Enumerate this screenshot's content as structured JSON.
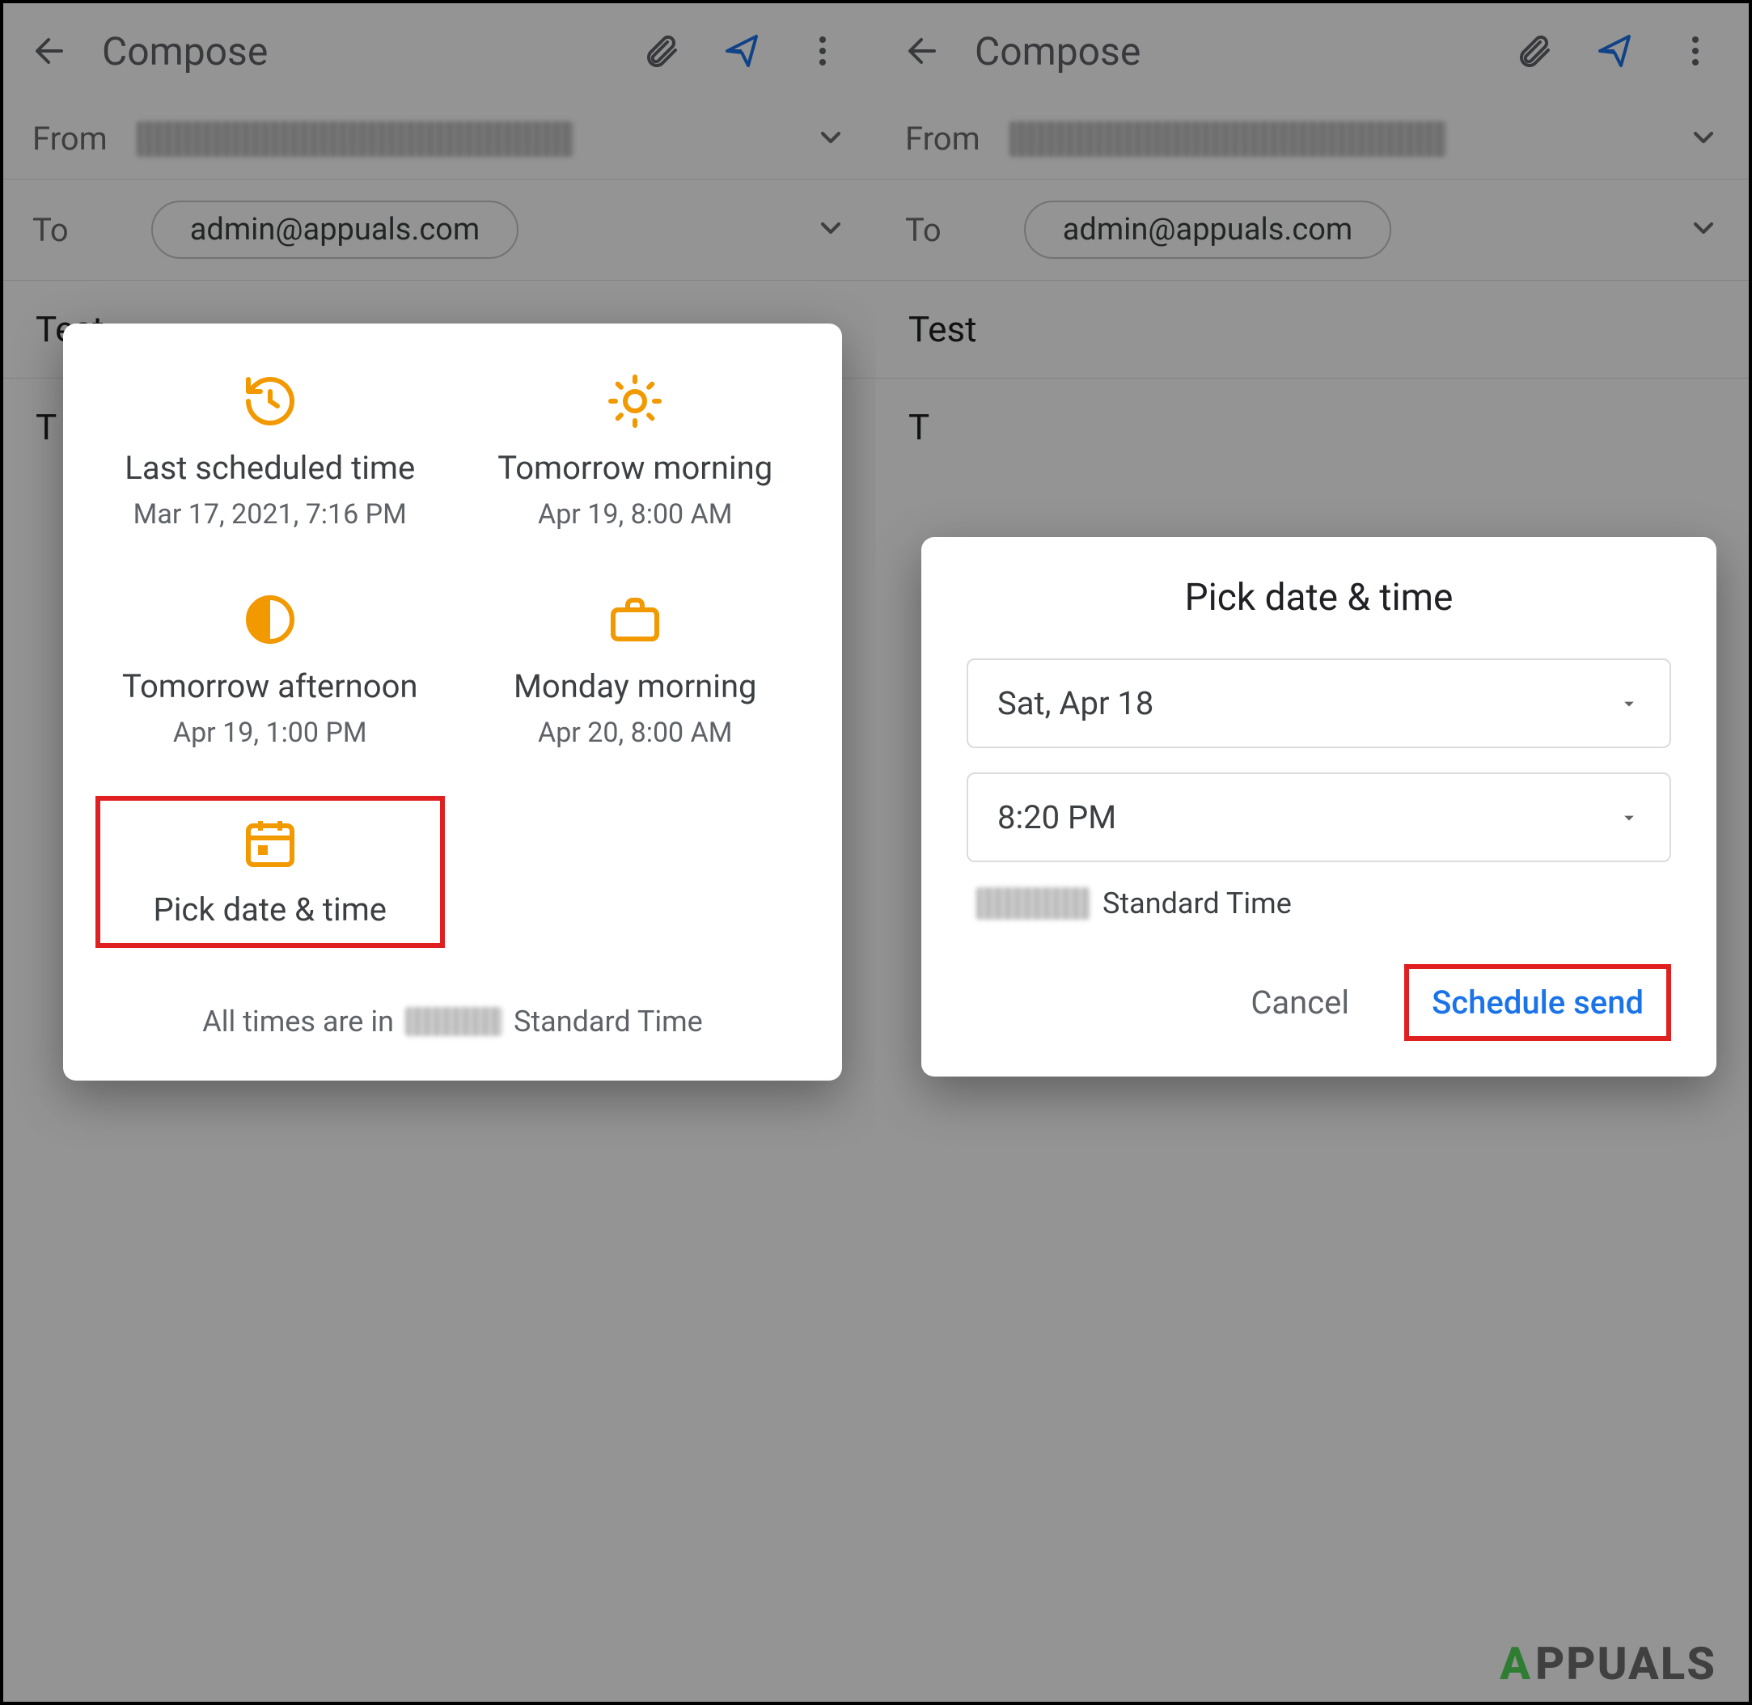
{
  "appbar": {
    "title": "Compose"
  },
  "from_label": "From",
  "to_label": "To",
  "to_chip": "admin@appuals.com",
  "subject": "Test",
  "body_initial": "T",
  "schedule": {
    "options": [
      {
        "label": "Last scheduled time",
        "sub": "Mar 17, 2021, 7:16 PM"
      },
      {
        "label": "Tomorrow morning",
        "sub": "Apr 19, 8:00 AM"
      },
      {
        "label": "Tomorrow afternoon",
        "sub": "Apr 19, 1:00 PM"
      },
      {
        "label": "Monday morning",
        "sub": "Apr 20, 8:00 AM"
      },
      {
        "label": "Pick date & time",
        "sub": ""
      }
    ],
    "footer_prefix": "All times are in",
    "footer_suffix": "Standard Time"
  },
  "pick": {
    "title": "Pick date & time",
    "date": "Sat, Apr 18",
    "time": "8:20 PM",
    "tz_suffix": "Standard Time",
    "cancel": "Cancel",
    "confirm": "Schedule send"
  },
  "watermark": "PPUALS"
}
